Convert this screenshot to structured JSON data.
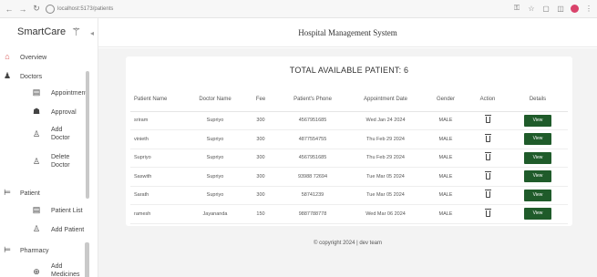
{
  "browser": {
    "url": "localhost:5173/patients",
    "back_icon": "arrow-left-icon",
    "forward_icon": "arrow-right-icon",
    "reload_icon": "reload-icon"
  },
  "sidebar": {
    "brand": "SmartCare",
    "items": [
      {
        "label": "Overview"
      },
      {
        "label": "Doctors"
      },
      {
        "label": "Appointment"
      },
      {
        "label": "Approval"
      },
      {
        "label": "Add Doctor"
      },
      {
        "label": "Delete Doctor"
      },
      {
        "label": "Patient"
      },
      {
        "label": "Patient List"
      },
      {
        "label": "Add Patient"
      },
      {
        "label": "Pharmacy"
      },
      {
        "label": "Add Medicines"
      }
    ]
  },
  "header": {
    "title": "Hospital Management System"
  },
  "main": {
    "card_title": "TOTAL AVAILABLE PATIENT: 6",
    "columns": [
      "Patient Name",
      "Doctor Name",
      "Fee",
      "Patient's Phone",
      "Appointment Date",
      "Gender",
      "Action",
      "Details"
    ],
    "rows": [
      {
        "name": "sriram",
        "doctor": "Supriyo",
        "fee": "300",
        "phone": "4567951685",
        "date": "Wed Jan 24 2024",
        "gender": "MALE",
        "view": "View"
      },
      {
        "name": "vinieth",
        "doctor": "Supriyo",
        "fee": "300",
        "phone": "4877554755",
        "date": "Thu Feb 29 2024",
        "gender": "MALE",
        "view": "View"
      },
      {
        "name": "Supriyo",
        "doctor": "Supriyo",
        "fee": "300",
        "phone": "4567951685",
        "date": "Thu Feb 29 2024",
        "gender": "MALE",
        "view": "View"
      },
      {
        "name": "Saswith",
        "doctor": "Supriyo",
        "fee": "300",
        "phone": "93988 72694",
        "date": "Tue Mar 05 2024",
        "gender": "MALE",
        "view": "View"
      },
      {
        "name": "Sarath",
        "doctor": "Supriyo",
        "fee": "300",
        "phone": "58741239",
        "date": "Tue Mar 05 2024",
        "gender": "MALE",
        "view": "View"
      },
      {
        "name": "ramesh",
        "doctor": "Jayananda",
        "fee": "150",
        "phone": "9887788778",
        "date": "Wed Mar 06 2024",
        "gender": "MALE",
        "view": "View"
      }
    ]
  },
  "footer": {
    "text": "© copyright 2024 | dev team"
  },
  "colors": {
    "view_button": "#1f5b2a",
    "page_bg": "#f3f3f3"
  }
}
